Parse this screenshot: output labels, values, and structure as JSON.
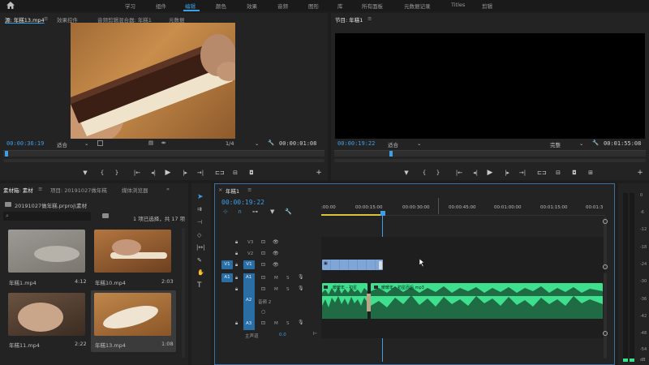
{
  "workspace": {
    "home_icon": "home-icon",
    "tabs": [
      "学习",
      "组件",
      "编辑",
      "颜色",
      "效果",
      "音频",
      "图形",
      "库",
      "所有面板",
      "元数据记录",
      "Titles",
      "剪辑"
    ],
    "active": "编辑"
  },
  "source_panel": {
    "tabs": [
      "源: 年糕13.mp4",
      "效果控件",
      "音频剪辑混合器: 年糕1",
      "元数据"
    ],
    "timecode": "00:00:36:19",
    "fit": "适合",
    "ratio": "1/4",
    "duration": "00:00:01:08"
  },
  "program_panel": {
    "tab": "节目: 年糕1",
    "timecode": "00:00:19:22",
    "fit": "适合",
    "quality": "完整",
    "duration": "00:01:55:08"
  },
  "project_panel": {
    "tabs": [
      "素材箱: 素材",
      "项目: 20191027做年糕",
      "媒体浏览器"
    ],
    "path": "20191027做年糕.prproj\\素材",
    "status": "1 项已选择，共 17 项",
    "items": [
      {
        "name": "年糕1.mp4",
        "duration": "4:12"
      },
      {
        "name": "年糕10.mp4",
        "duration": "2:03"
      },
      {
        "name": "年糕11.mp4",
        "duration": "2:22"
      },
      {
        "name": "年糕13.mp4",
        "duration": "1:08"
      }
    ]
  },
  "timeline": {
    "tab": "年糕1",
    "timecode": "00:00:19:22",
    "ruler": [
      ":00:00",
      "00:00:15:00",
      "00:00:30:00",
      "00:00:45:00",
      "00:01:00:00",
      "00:01:15:00",
      "00:01:3"
    ],
    "tracks": {
      "v3": "V3",
      "v2": "V2",
      "v1": "V1",
      "a1": "A1",
      "a2": "A2",
      "a3": "A3",
      "v1_src": "V1",
      "a1_src": "A1",
      "audio2_label": "音频 2",
      "master": "主声道",
      "master_val": "0.0",
      "m": "M",
      "s": "S"
    },
    "clips": {
      "audio1_name": "暖暖年 - 初星",
      "audio2_name": "暖暖年 - 初星而后.mp3"
    }
  },
  "meter": {
    "labels": [
      "0",
      "-6",
      "-12",
      "-18",
      "-24",
      "-30",
      "-36",
      "-42",
      "-48",
      "-54",
      "dB"
    ]
  }
}
